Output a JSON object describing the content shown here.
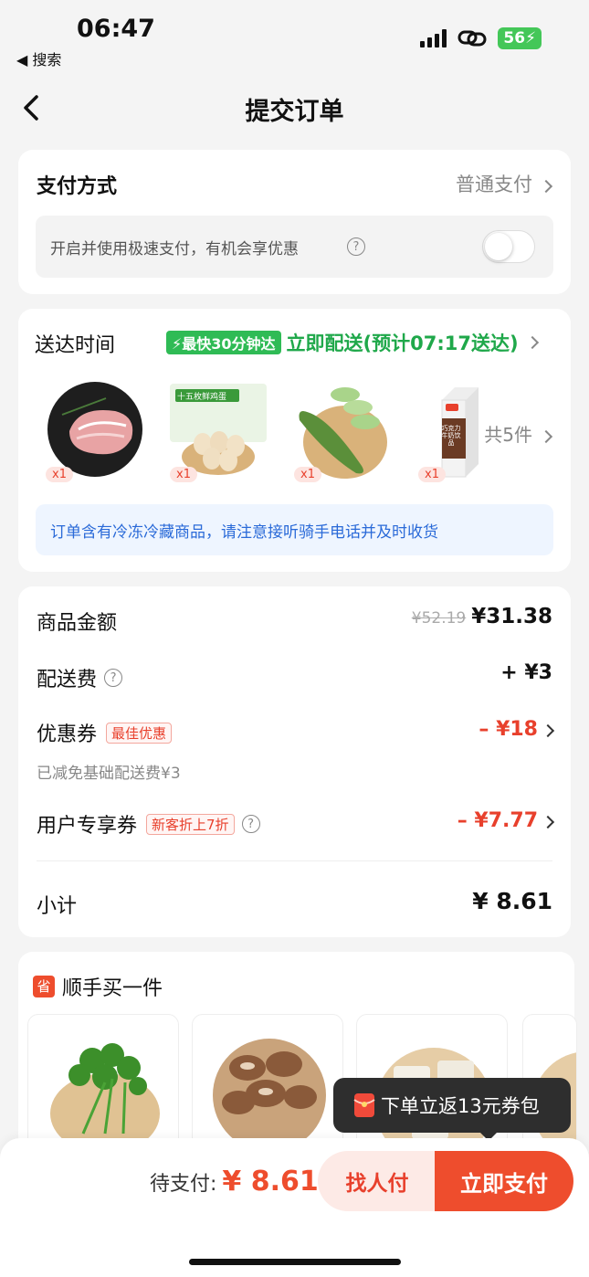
{
  "status": {
    "time": "06:47",
    "back_app": "◀ 搜索",
    "battery": "56"
  },
  "nav": {
    "title": "提交订单"
  },
  "payment": {
    "title": "支付方式",
    "method": "普通支付",
    "fast_pay_text": "开启并使用极速支付，有机会享优惠",
    "fast_pay_enabled": false
  },
  "delivery": {
    "title": "送达时间",
    "badge": "最快30分钟达",
    "eta": "立即配送(预计07:17送达)",
    "count_text": "共5件",
    "products": [
      {
        "name": "pork",
        "qty": "x1"
      },
      {
        "name": "eggs",
        "qty": "x1",
        "label": "十五枚鲜鸡蛋"
      },
      {
        "name": "bitter-melon",
        "qty": "x1"
      },
      {
        "name": "chocolate-milk",
        "qty": "x1",
        "label": "巧克力牛奶饮品"
      }
    ],
    "notice": "订单含有冷冻冷藏商品，请注意接听骑手电话并及时收货"
  },
  "price": {
    "goods_label": "商品金额",
    "goods_original": "¥52.19",
    "goods_price": "¥31.38",
    "delivery_label": "配送费",
    "delivery_value": "+ ¥3",
    "coupon_label": "优惠券",
    "coupon_tag": "最佳优惠",
    "coupon_value": "– ¥18",
    "coupon_note": "已减免基础配送费¥3",
    "user_coupon_label": "用户专享券",
    "user_coupon_tag": "新客折上7折",
    "user_coupon_value": "– ¥7.77",
    "subtotal_label": "小计",
    "subtotal_value": "¥ 8.61"
  },
  "suggest": {
    "icon_text": "省",
    "title": "顺手买一件",
    "items": [
      "coriander",
      "shiitake",
      "radish"
    ]
  },
  "tooltip": {
    "text": "下单立返13元券包"
  },
  "bottom": {
    "pending_label": "待支付:",
    "pending_value": "¥ 8.61",
    "friend_pay": "找人付",
    "pay_now": "立即支付"
  },
  "colors": {
    "accent": "#ee4d2d",
    "green": "#2fbb55",
    "notice_bg": "#eef5ff",
    "notice_text": "#2a6ad8"
  }
}
